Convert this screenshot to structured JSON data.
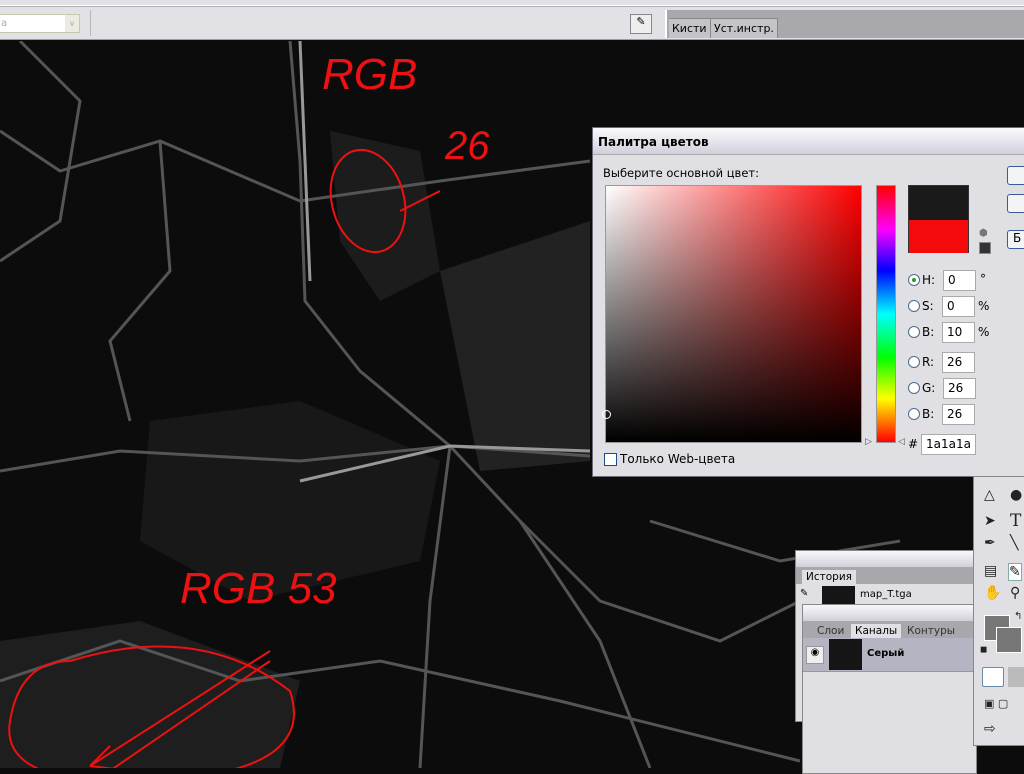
{
  "toolbar": {
    "combo_value": "а",
    "panel_well_tabs": [
      "Кисти",
      "Уст.инстр."
    ]
  },
  "annotations": {
    "top_label": "RGB",
    "top_value": "26",
    "bottom_label": "RGB 53",
    "color": "#ee1111"
  },
  "color_picker": {
    "title": "Палитра цветов",
    "prompt": "Выберите основной цвет:",
    "fields": {
      "H": "0",
      "S": "0",
      "B_hsb": "10",
      "R": "26",
      "G": "26",
      "B_rgb": "26"
    },
    "labels": {
      "H": "H:",
      "S": "S:",
      "B_hsb": "B:",
      "R": "R:",
      "G": "G:",
      "B_rgb": "B:"
    },
    "units": {
      "deg": "°",
      "pct": "%"
    },
    "hex_label": "#",
    "hex": "1a1a1a",
    "web_only_label": "Только Web-цвета",
    "button_partial": "Б",
    "new_color": "#1a1a1a",
    "old_color": "#f40a0a"
  },
  "history_panel": {
    "tab": "История",
    "item": "map_T.tga"
  },
  "channels_panel": {
    "tabs": [
      "Слои",
      "Каналы",
      "Контуры"
    ],
    "channel": "Серый"
  }
}
